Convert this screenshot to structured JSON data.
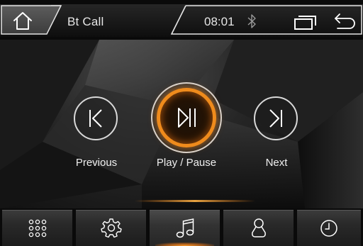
{
  "status_bar": {
    "title": "Bt Call",
    "time": "08:01",
    "icons": [
      "home-icon",
      "bluetooth-icon",
      "window-icon",
      "back-icon"
    ]
  },
  "controls": {
    "previous_label": "Previous",
    "play_pause_label": "Play / Pause",
    "next_label": "Next"
  },
  "dock": {
    "items": [
      {
        "icon": "apps-grid-icon",
        "active": false
      },
      {
        "icon": "settings-icon",
        "active": false
      },
      {
        "icon": "music-note-icon",
        "active": true
      },
      {
        "icon": "contacts-icon",
        "active": false
      },
      {
        "icon": "clock-icon",
        "active": false
      }
    ]
  },
  "colors": {
    "accent": "#ef8b1c",
    "text": "#efefef",
    "background": "#121212"
  }
}
